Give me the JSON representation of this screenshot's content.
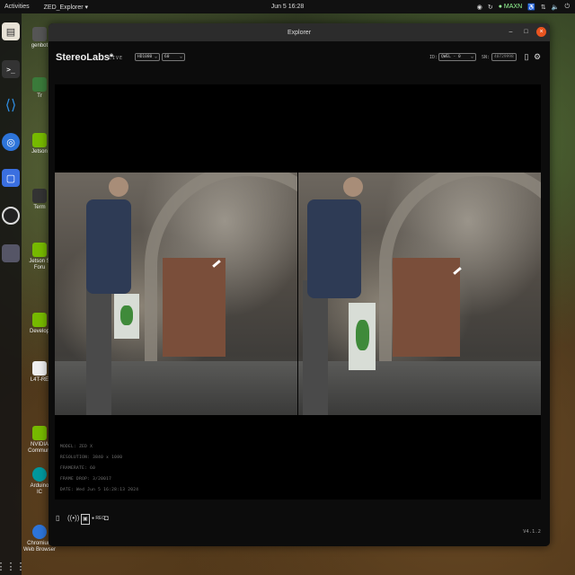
{
  "topbar": {
    "activities": "Activities",
    "app_menu": "ZED_Explorer ▾",
    "clock": "Jun 5 16:28",
    "maxn": "MAXN"
  },
  "desktop_icons": [
    "genbot",
    "Tr",
    "Jetson",
    "Term",
    "Jetson S Foru",
    "Develop",
    "L4T-RE",
    "NVIDIA Communi",
    "Arduino IC",
    "Chromium Web Browser"
  ],
  "window": {
    "title": "Explorer",
    "minimize": "–",
    "maximize": "□",
    "close": "×"
  },
  "header": {
    "brand": "StereoLabs*",
    "live": "LIVE",
    "resolution": "HD1080",
    "fps": "60",
    "id_label": "ID:",
    "id_value": "QWEL - 0",
    "sn_label": "SN:",
    "sn_value": "40729998"
  },
  "meta": {
    "model": "MODEL: ZED X",
    "resolution": "RESOLUTION: 3840 x 1080",
    "framerate": "FRAMERATE: 60",
    "frame_drop": "FRAME DROP: 3/20017",
    "date": "DATE: Wed Jun 5 16:28:13 2024"
  },
  "bottom": {
    "rec": "REC",
    "version": "V4.1.2"
  }
}
